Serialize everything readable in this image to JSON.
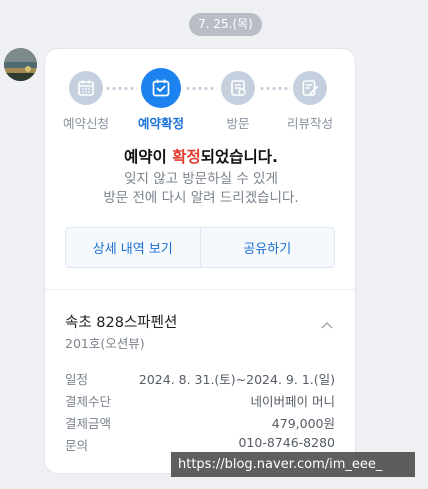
{
  "chat": {
    "date_label": "7. 25.(목)"
  },
  "steps": [
    {
      "label": "예약신청",
      "icon": "calendar-icon",
      "active": false
    },
    {
      "label": "예약확정",
      "icon": "calendar-check-icon",
      "active": true
    },
    {
      "label": "방문",
      "icon": "store-icon",
      "active": false
    },
    {
      "label": "리뷰작성",
      "icon": "pencil-note-icon",
      "active": false
    }
  ],
  "message": {
    "headline_prefix": "예약이 ",
    "headline_highlight": "확정",
    "headline_suffix": "되었습니다.",
    "sub_line1": "잊지 않고 방문하실 수 있게",
    "sub_line2": "방문 전에 다시 알려 드리겠습니다."
  },
  "actions": {
    "detail_label": "상세 내역 보기",
    "share_label": "공유하기"
  },
  "reservation": {
    "place": "속초 828스파펜션",
    "room": "201호(오션뷰)",
    "details": [
      {
        "key": "일정",
        "value": "2024. 8. 31.(토)~2024. 9. 1.(일)"
      },
      {
        "key": "결제수단",
        "value": "네이버페이 머니"
      },
      {
        "key": "결제금액",
        "value": "479,000원"
      },
      {
        "key": "문의",
        "value": "010-8746-8280"
      }
    ]
  },
  "watermark": {
    "text": "https://blog.naver.com/im_eee_"
  },
  "colors": {
    "accent": "#1b82f0",
    "highlight": "#e23b2e",
    "inactive_step": "#c5cfdd"
  }
}
